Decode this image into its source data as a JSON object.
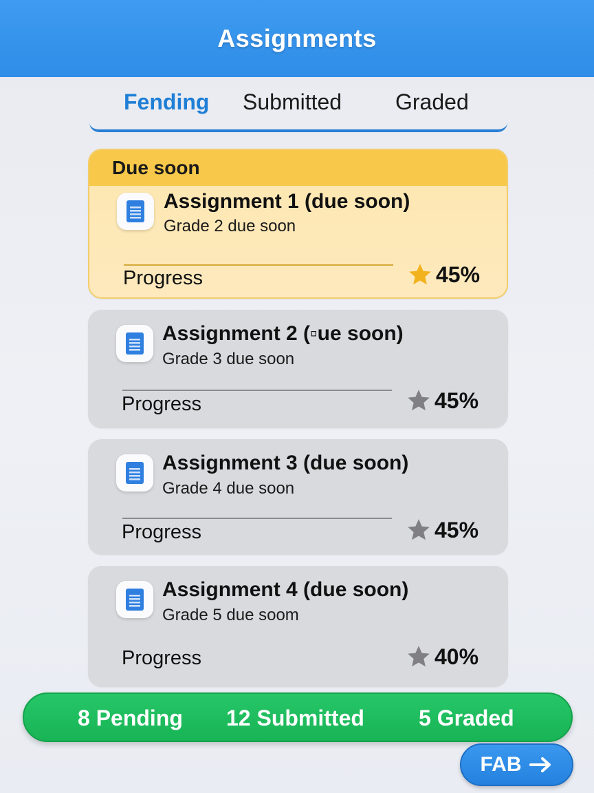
{
  "app": {
    "title": "Assignments"
  },
  "tabs": [
    {
      "label": "Fending",
      "active": true
    },
    {
      "label": "Submitted",
      "active": false
    },
    {
      "label": "Graded",
      "active": false
    }
  ],
  "banner": {
    "label": "Due soon"
  },
  "progress_label": "Progress",
  "assignments": [
    {
      "title": "Assignment 1 (due soon)",
      "subtitle": "Grade 2 due soon",
      "percent": "45%",
      "progress": 0.45,
      "star_color": "#f2b21e",
      "icon": "document-icon"
    },
    {
      "title": "Assignment 2 (▫ue soon)",
      "subtitle": "Grade 3 due soon",
      "percent": "45%",
      "progress": 0.45,
      "star_color": "#808084",
      "icon": "document-icon"
    },
    {
      "title": "Assignment 3 (due soon)",
      "subtitle": "Grade 4 due soon",
      "percent": "45%",
      "progress": 0.45,
      "star_color": "#808084",
      "icon": "document-icon"
    },
    {
      "title": "Assignment 4 (due soon)",
      "subtitle": "Grade 5 due soom",
      "percent": "40%",
      "progress": 0.4,
      "star_color": "#808084",
      "icon": "document-icon"
    }
  ],
  "stats": {
    "pending": "8 Pending",
    "submitted": "12 Submitted",
    "graded": "5 Graded"
  },
  "fab": {
    "label": "FAB",
    "icon": "arrow-right-icon"
  },
  "colors": {
    "app_bar": "#2f8de8",
    "accent": "#1f7fd6",
    "due_banner": "#f8c84a",
    "stats_bar": "#18b455"
  }
}
